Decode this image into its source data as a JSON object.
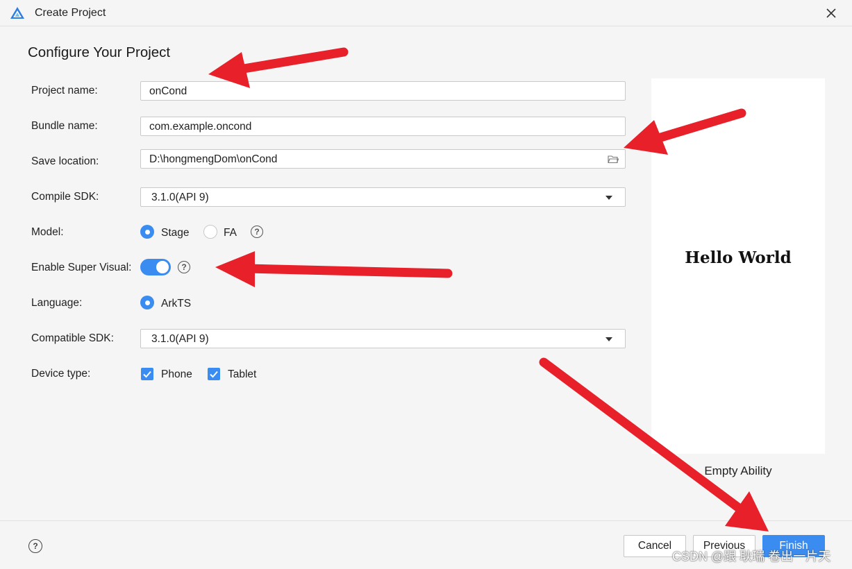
{
  "window": {
    "title": "Create Project"
  },
  "page_heading": "Configure Your Project",
  "form": {
    "project_name": {
      "label": "Project name:",
      "value": "onCond"
    },
    "bundle_name": {
      "label": "Bundle name:",
      "value": "com.example.oncond"
    },
    "save_location": {
      "label": "Save location:",
      "value": "D:\\hongmengDom\\onCond"
    },
    "compile_sdk": {
      "label": "Compile SDK:",
      "value": "3.1.0(API 9)"
    },
    "model": {
      "label": "Model:",
      "options": [
        "Stage",
        "FA"
      ],
      "selected": "Stage"
    },
    "super_visual": {
      "label": "Enable Super Visual:",
      "enabled": true
    },
    "language": {
      "label": "Language:",
      "options": [
        "ArkTS"
      ],
      "selected": "ArkTS"
    },
    "compatible_sdk": {
      "label": "Compatible SDK:",
      "value": "3.1.0(API 9)"
    },
    "device_type": {
      "label": "Device type:",
      "options": [
        "Phone",
        "Tablet"
      ],
      "checked": [
        "Phone",
        "Tablet"
      ]
    }
  },
  "preview": {
    "text": "Hello World",
    "template_name": "Empty Ability"
  },
  "footer": {
    "cancel_label": "Cancel",
    "previous_label": "Previous",
    "finish_label": "Finish"
  },
  "watermark": "CSDN @跟 耿瑞 卷出一片天",
  "colors": {
    "accent": "#3b8cf0",
    "annotation_arrow": "#e8202a",
    "background": "#f5f5f5"
  },
  "icons": [
    "app-logo-icon",
    "close-icon",
    "folder-icon",
    "dropdown-arrow-icon",
    "help-icon",
    "checkmark-icon"
  ]
}
